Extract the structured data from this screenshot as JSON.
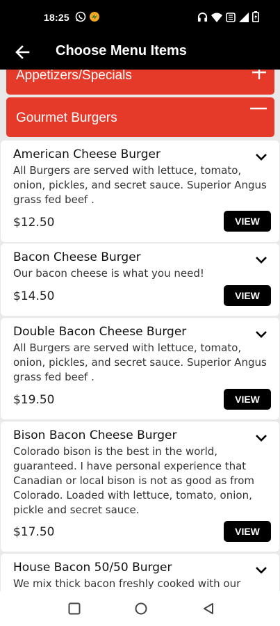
{
  "status_bar": {
    "time": "18:25",
    "left_icons": [
      "whatsapp-icon",
      "app-icon"
    ],
    "right_icons": [
      "headphones-icon",
      "wifi-icon",
      "data-icon",
      "signal-icon",
      "battery-icon"
    ]
  },
  "app_bar": {
    "title": "Choose Menu Items"
  },
  "categories": [
    {
      "label": "Appetizers/Specials",
      "toggle": "+"
    },
    {
      "label": "Gourmet Burgers",
      "toggle": "−"
    }
  ],
  "items": [
    {
      "name": "American Cheese Burger",
      "desc": "All Burgers are served with lettuce, tomato, onion, pickles, and secret sauce. Superior Angus grass fed beef .",
      "price": "$12.50",
      "button": "VIEW"
    },
    {
      "name": "Bacon Cheese Burger",
      "desc": "Our bacon cheese is what you need!",
      "price": "$14.50",
      "button": "VIEW"
    },
    {
      "name": "Double Bacon Cheese Burger",
      "desc": "All Burgers are served with lettuce, tomato, onion, pickles, and secret sauce. Superior Angus grass fed beef .",
      "price": "$19.50",
      "button": "VIEW"
    },
    {
      "name": "Bison Bacon Cheese Burger",
      "desc": "Colorado bison is the best in the world, guaranteed. I have personal experience that Canadian or local bison is not as good as from Colorado. Loaded with lettuce, tomato, onion, pickle and secret sauce.",
      "price": "$17.50",
      "button": "VIEW"
    },
    {
      "name": "House Bacon 50/50 Burger",
      "desc": "We mix thick bacon freshly cooked with our"
    }
  ],
  "colors": {
    "accent": "#e53a2a",
    "bar": "#000000",
    "button": "#000000"
  },
  "nav": [
    "recents-icon",
    "home-icon",
    "back-icon"
  ]
}
